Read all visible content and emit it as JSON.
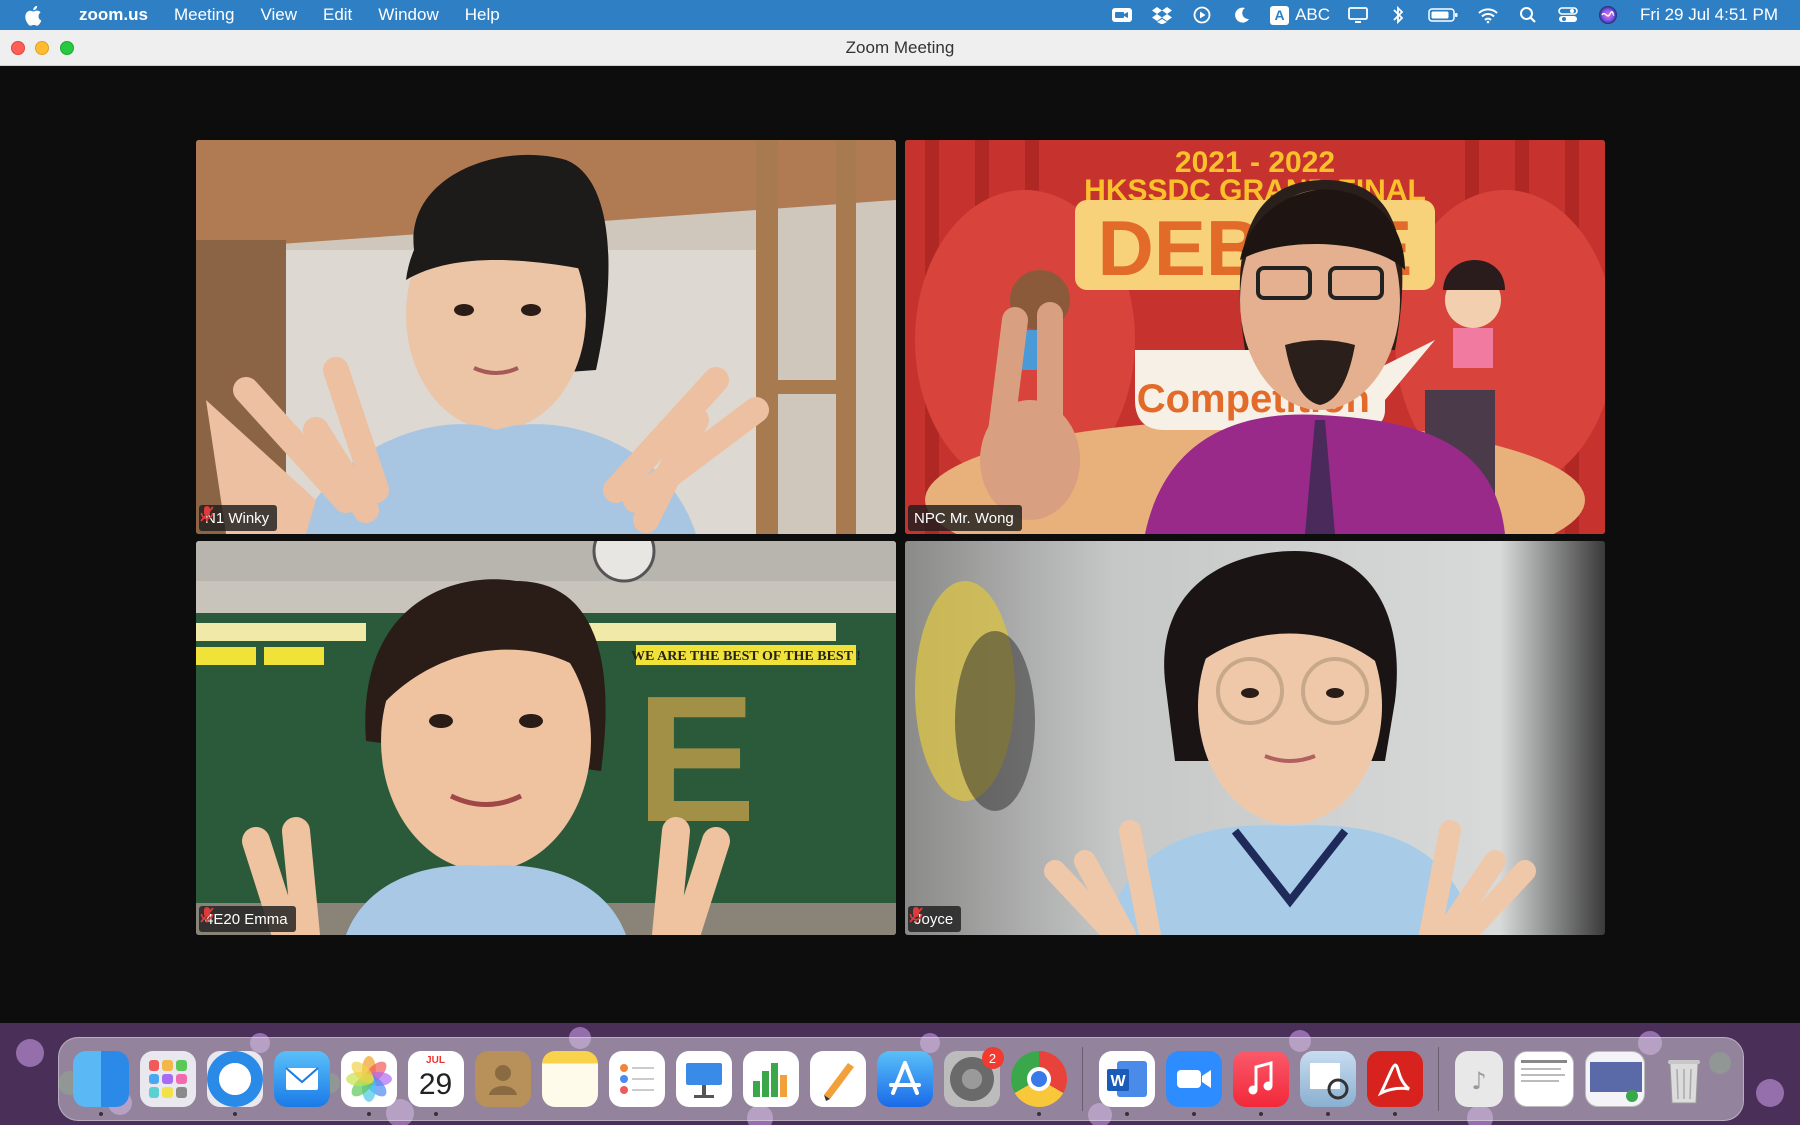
{
  "menubar": {
    "app_name": "zoom.us",
    "menus": [
      "Meeting",
      "View",
      "Edit",
      "Window",
      "Help"
    ],
    "input_source": "ABC",
    "clock": "Fri 29 Jul  4:51 PM",
    "status_icons": [
      "zoom-icon",
      "dropbox-icon",
      "play-icon",
      "moon-icon",
      "input-source-icon",
      "display-icon",
      "bluetooth-icon",
      "battery-icon",
      "wifi-icon",
      "search-icon",
      "control-center-icon",
      "siri-icon"
    ]
  },
  "window": {
    "title": "Zoom Meeting"
  },
  "participants": [
    {
      "name": "N1 Winky",
      "muted": true,
      "active_speaker": false
    },
    {
      "name": "NPC Mr. Wong",
      "muted": false,
      "active_speaker": true
    },
    {
      "name": "4E20 Emma",
      "muted": true,
      "active_speaker": false
    },
    {
      "name": "Joyce",
      "muted": true,
      "active_speaker": false
    }
  ],
  "wong_background": {
    "line1": "2021 - 2022",
    "line2": "HKSSDC GRAND FINAL",
    "sign": "DEBATE",
    "bubble": "Competition"
  },
  "emma_background": {
    "banner_en": "WE ARE THE BEST OF THE BEST !",
    "board_letter": "E"
  },
  "dock": {
    "calendar_month": "JUL",
    "calendar_day": "29",
    "settings_badge": "2",
    "apps": [
      "finder-icon",
      "launchpad-icon",
      "safari-icon",
      "mail-icon",
      "photos-icon",
      "calendar-icon",
      "contacts-icon",
      "notes-icon",
      "reminders-icon",
      "keynote-icon",
      "numbers-icon",
      "pages-icon",
      "app-store-icon",
      "system-preferences-icon",
      "chrome-icon",
      "word-icon",
      "zoom-app-icon",
      "music-icon",
      "preview-icon",
      "acrobat-icon",
      "music-file-icon",
      "document-thumbnail-icon",
      "screenshot-thumbnail-icon",
      "trash-icon"
    ]
  }
}
